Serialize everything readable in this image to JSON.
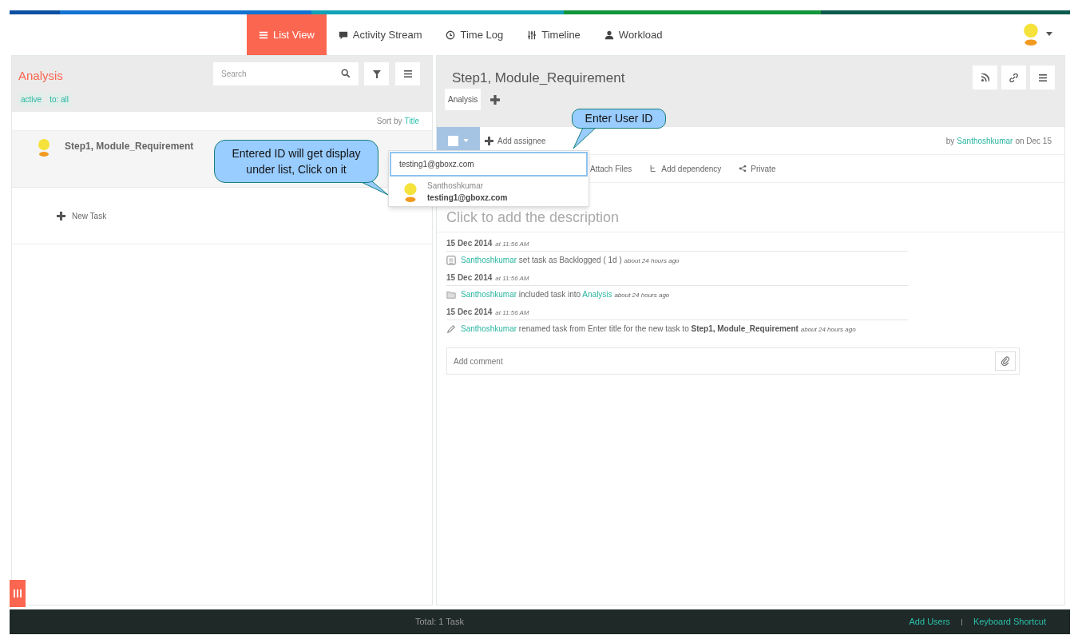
{
  "nav": {
    "tabs": [
      {
        "label": "List View",
        "selected": true
      },
      {
        "label": "Activity Stream",
        "selected": false
      },
      {
        "label": "Time Log",
        "selected": false
      },
      {
        "label": "Timeline",
        "selected": false
      },
      {
        "label": "Workload",
        "selected": false
      }
    ]
  },
  "left": {
    "title": "Analysis",
    "search_placeholder": "Search",
    "filters": [
      "active",
      "to: all"
    ],
    "sort_label": "Sort by",
    "sort_value": "Title",
    "tasks": [
      {
        "title": "Step1, Module_Requirement"
      }
    ],
    "new_task": "New Task"
  },
  "right": {
    "title": "Step1, Module_Requirement",
    "tags": [
      "Analysis"
    ],
    "assignee": "Add assignee",
    "by": "by",
    "author": "Santhoshkumar",
    "on": "on Dec 15",
    "actions": [
      "Attach Files",
      "Add dependency",
      "Private"
    ],
    "description_placeholder": "Click to add the description",
    "activity": [
      {
        "date": "15 Dec 2014",
        "time": "at 11:56 AM",
        "segments": [
          {
            "kind": "link",
            "text": "Santhoshkumar"
          },
          {
            "kind": "plain",
            "text": "set task as Backlogged ( 1d )"
          },
          {
            "kind": "ago",
            "text": "about 24 hours ago"
          }
        ]
      },
      {
        "date": "15 Dec 2014",
        "time": "at 11:56 AM",
        "segments": [
          {
            "kind": "link",
            "text": "Santhoshkumar"
          },
          {
            "kind": "plain",
            "text": "included task into"
          },
          {
            "kind": "link",
            "text": "Analysis"
          },
          {
            "kind": "ago",
            "text": "about 24 hours ago"
          }
        ]
      },
      {
        "date": "15 Dec 2014",
        "time": "at 11:56 AM",
        "segments": [
          {
            "kind": "link",
            "text": "Santhoshkumar"
          },
          {
            "kind": "plain",
            "text": "renamed task from Enter title for the new task to"
          },
          {
            "kind": "bold",
            "text": "Step1, Module_Requirement"
          },
          {
            "kind": "ago",
            "text": "about 24 hours ago"
          }
        ]
      }
    ],
    "comment_placeholder": "Add comment"
  },
  "dropdown": {
    "value": "testing1@gboxz.com",
    "results": [
      {
        "name": "Santhoshkumar",
        "email": "testing1@gboxz.com"
      }
    ]
  },
  "callouts": [
    "Entered ID will get display under list, Click on it",
    "Enter User ID"
  ],
  "footer": {
    "total": "Total: 1 Task",
    "links": [
      "Add Users",
      "Keyboard Shortcut"
    ]
  }
}
